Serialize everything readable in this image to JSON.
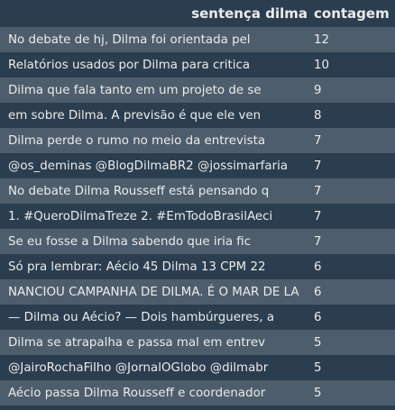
{
  "chart_data": {
    "type": "table",
    "columns": [
      "sentença dilma",
      "contagem"
    ],
    "rows": [
      [
        "No debate de hj, Dilma foi orientada pel",
        12
      ],
      [
        "Relatórios usados por Dilma para critica",
        10
      ],
      [
        "Dilma que fala tanto em um projeto de se",
        9
      ],
      [
        "em sobre Dilma. A previsão é que ele ven",
        8
      ],
      [
        "Dilma perde o rumo no meio da entrevista",
        7
      ],
      [
        "@os_deminas @BlogDilmaBR2 @jossimarfaria",
        7
      ],
      [
        "No debate Dilma Rousseff está pensando q",
        7
      ],
      [
        "1. #QueroDilmaTreze 2. #EmTodoBrasilAeci",
        7
      ],
      [
        "Se eu fosse a Dilma sabendo que iria fic",
        7
      ],
      [
        "Só pra lembrar: Aécio 45 Dilma 13 CPM 22",
        6
      ],
      [
        "NANCIOU CAMPANHA DE DILMA. É O MAR DE LA",
        6
      ],
      [
        "— Dilma ou Aécio? — Dois hambúrgueres, a",
        6
      ],
      [
        "Dilma se atrapalha e passa mal em entrev",
        5
      ],
      [
        "@JairoRochaFilho @JornalOGlobo @dilmabr",
        5
      ],
      [
        "Aécio passa Dilma Rousseff e coordenador",
        5
      ]
    ]
  },
  "colors": {
    "background": "#2b3e50",
    "row_stripe": "#4e5d6c",
    "text": "#ebebeb"
  }
}
